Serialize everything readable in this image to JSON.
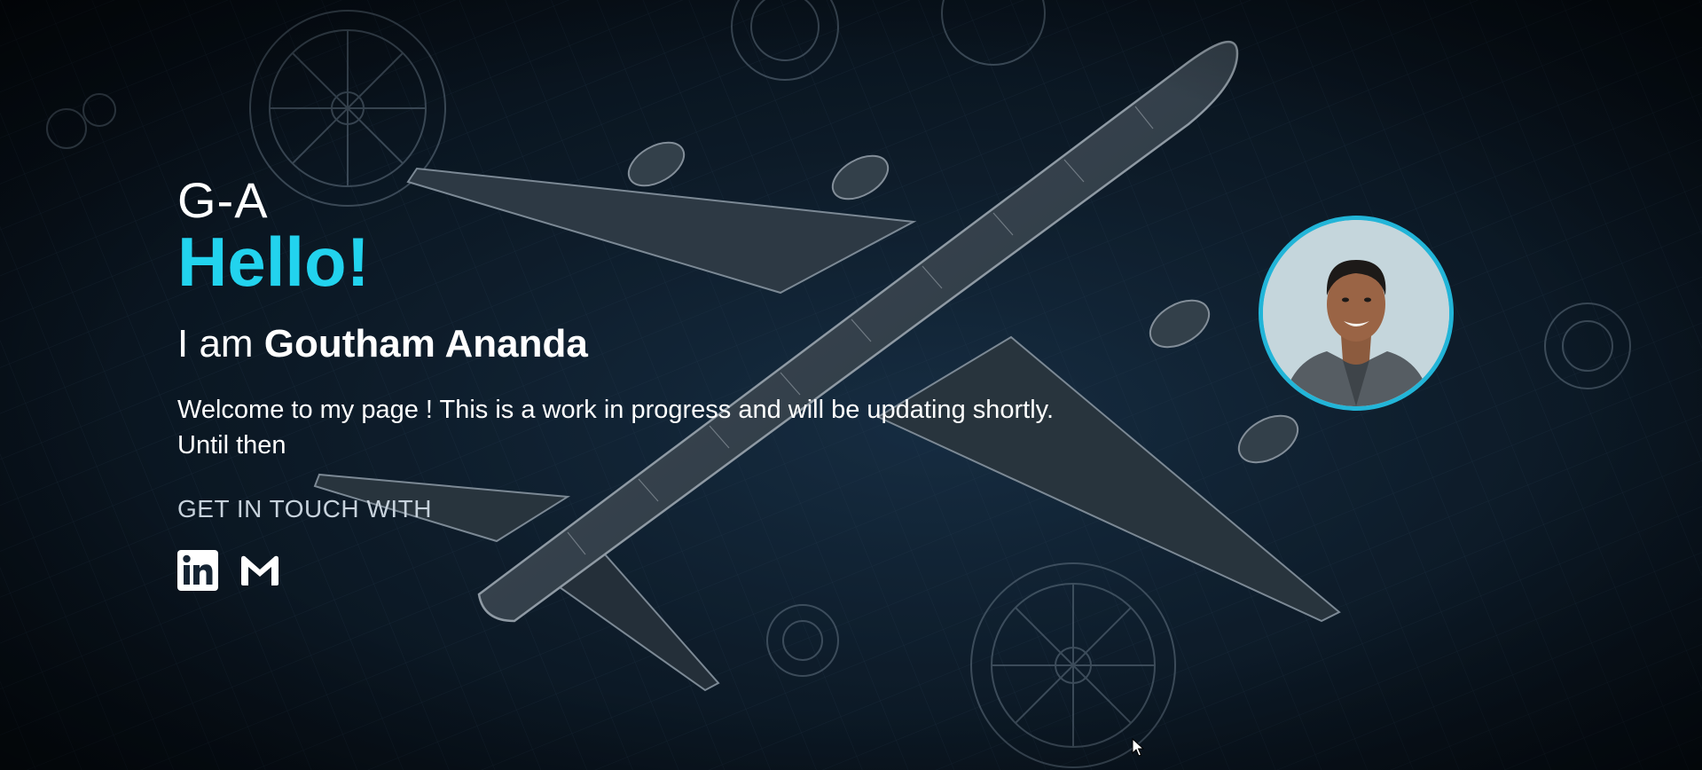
{
  "hero": {
    "logo": "G-A",
    "greeting": "Hello!",
    "intro_prefix": "I am ",
    "name": "Goutham Ananda",
    "welcome_line1": "Welcome to my page ! This is a work in progress and will be updating shortly.",
    "welcome_line2": "Until then",
    "get_in_touch": "GET IN TOUCH WITH"
  },
  "socials": [
    {
      "name": "linkedin",
      "icon": "linkedin-icon"
    },
    {
      "name": "gmail",
      "icon": "gmail-icon"
    }
  ],
  "colors": {
    "accent": "#22d3ee",
    "avatar_border": "#22b5d8",
    "text": "#ffffff",
    "background": "#0d1a26"
  }
}
